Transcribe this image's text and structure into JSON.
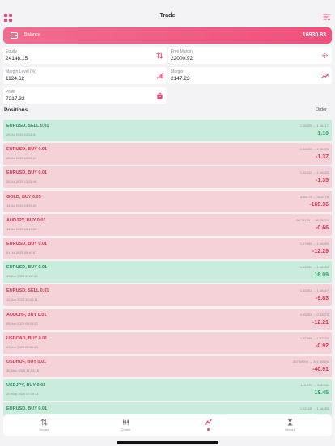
{
  "header": {
    "title": "Trade"
  },
  "balance": {
    "label": "Balance",
    "value": "16930.83"
  },
  "stats": [
    {
      "label": "Equity",
      "value": "24148.15",
      "icon": "arrows-updown-icon"
    },
    {
      "label": "Free Margin",
      "value": "22000.92",
      "icon": "move-icon"
    },
    {
      "label": "Margin Level (%)",
      "value": "1124.62",
      "icon": "signal-bars-icon"
    },
    {
      "label": "Margin",
      "value": "2147.23",
      "icon": "trend-icon"
    },
    {
      "label": "Profit",
      "value": "7217.32",
      "icon": "bag-icon"
    }
  ],
  "positions": {
    "heading": "Positions",
    "order_label": "Order",
    "items": [
      {
        "symbol": "EURUSD, SELL 0.01",
        "date": "28 Jul 2025 12:52:34",
        "prices": "1.16425 → 1.16417",
        "profit": "1.10",
        "status": "green"
      },
      {
        "symbol": "EURUSD, BUY 0.01",
        "date": "28 Jul 2025 12:52:29",
        "prices": "1.16420 → 1.16423",
        "profit": "-1.37",
        "status": "red"
      },
      {
        "symbol": "EURUSD, BUY 0.01",
        "date": "28 Jul 2025 12:51:49",
        "prices": "1.16432 → 1.16433",
        "profit": "-1.35",
        "status": "red"
      },
      {
        "symbol": "GOLD, BUY 0.05",
        "date": "14 Jul 2025 19:39:25",
        "prices": "3368.75 → 3120.76",
        "profit": "-169.36",
        "status": "red"
      },
      {
        "symbol": "AUDJPY, BUY 0.01",
        "date": "14 Jul 2025 15:12:20",
        "prices": "96.78120 → 96.68224",
        "profit": "-0.66",
        "status": "red"
      },
      {
        "symbol": "EURUSD, BUY 0.01",
        "date": "01 Jul 2025 09:40:07",
        "prices": "1.17869 → 1.16455",
        "profit": "-12.29",
        "status": "red"
      },
      {
        "symbol": "EURUSD, BUY 0.01",
        "date": "13 Jun 2025 11:02:39",
        "prices": "1.14550 → 1.16433",
        "profit": "16.09",
        "status": "green"
      },
      {
        "symbol": "EURUSD, SELL 0.01",
        "date": "12 Jun 2025 10:44:11",
        "prices": "1.15353 → 1.16447",
        "profit": "-9.83",
        "status": "red"
      },
      {
        "symbol": "AUDCHF, BUY 0.01",
        "date": "05 Jun 2025 09:18:22",
        "prices": "0.53253 → 0.52075",
        "profit": "-12.21",
        "status": "red"
      },
      {
        "symbol": "USDCAD, BUY 0.01",
        "date": "03 Jun 2025 02:00:20",
        "prices": "1.37388 → 1.37235",
        "profit": "-0.92",
        "status": "red"
      },
      {
        "symbol": "USDHUF, BUY 0.01",
        "date": "30 May 2025 17:04:18",
        "prices": "357.09200 → 341.35500",
        "profit": "-40.91",
        "status": "red"
      },
      {
        "symbol": "USDJPY, BUY 0.01",
        "date": "20 May 2025 07:15:11",
        "prices": "144.370 → 148.011",
        "profit": "18.45",
        "status": "green"
      },
      {
        "symbol": "EURUSD, BUY 0.01",
        "date": "",
        "prices": "1.12128 → 1.16433",
        "profit": "",
        "status": "green"
      }
    ]
  },
  "tabs": [
    {
      "label": "Quotes",
      "icon": "quotes-icon"
    },
    {
      "label": "Charts",
      "icon": "charts-icon"
    },
    {
      "label": "",
      "icon": "trade-icon",
      "active": true
    },
    {
      "label": "History",
      "icon": "history-icon"
    }
  ],
  "colors": {
    "accent": "#e8457a",
    "profit_green": "#2fa36b",
    "loss_red": "#d9334f",
    "row_green": "#c9ecdc",
    "row_red": "#f5d2d8"
  }
}
